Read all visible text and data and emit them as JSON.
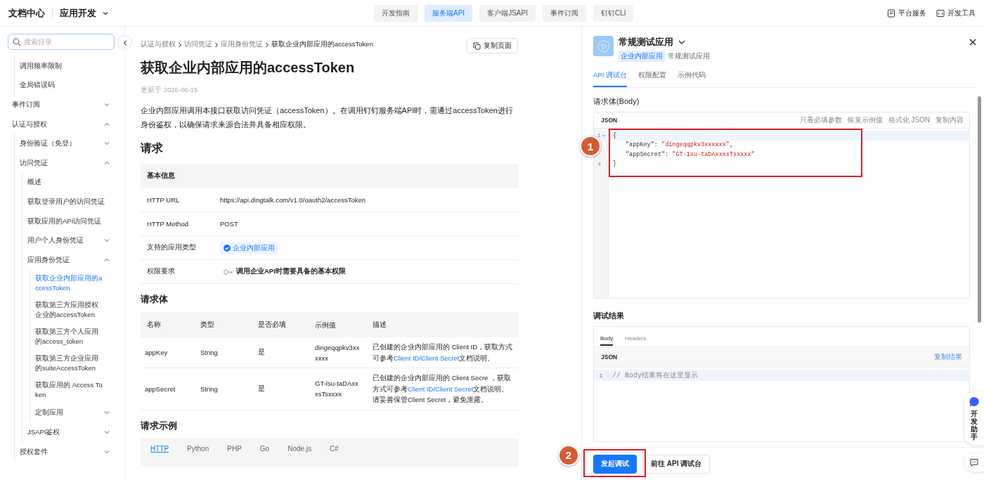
{
  "header": {
    "logo_text": "文档中心",
    "product": "应用开发",
    "nav_tabs": [
      {
        "label": "开发指南",
        "selected": false
      },
      {
        "label": "服务端API",
        "selected": true
      },
      {
        "label": "客户端JSAPI",
        "selected": false
      },
      {
        "label": "事件订阅",
        "selected": false
      },
      {
        "label": "钉钉CLI",
        "selected": false
      }
    ],
    "tools": [
      {
        "label": "平台服务",
        "kind": "doc"
      },
      {
        "label": "开发工具",
        "kind": "code"
      }
    ]
  },
  "sidebar": {
    "search": {
      "placeholder": "搜索目录"
    },
    "items": [
      {
        "children": [
          {
            "label": "调用频率限制",
            "selected": false
          },
          {
            "label": "全局错误码",
            "selected": false
          }
        ]
      },
      {
        "label": "事件订阅",
        "expanded": false,
        "selected": false
      },
      {
        "label": "认证与授权",
        "expanded": true,
        "selected": false,
        "children": [
          {
            "label": "身份验证（免登）",
            "expanded": false,
            "selected": false
          },
          {
            "label": "访问凭证",
            "expanded": true,
            "selected": false,
            "children": [
              {
                "label": "概述",
                "selected": false
              },
              {
                "label": "获取登录用户的访问凭证",
                "selected": false
              },
              {
                "label": "获取应用的API访问凭证",
                "selected": false
              },
              {
                "label": "用户个人身份凭证",
                "expanded": false,
                "selected": false
              },
              {
                "label": "应用身份凭证",
                "expanded": true,
                "selected": false,
                "children": [
                  {
                    "label": "获取企业内部应用的accessToken",
                    "selected": true
                  },
                  {
                    "label": "获取第三方应用授权企业的accessToken",
                    "selected": false
                  },
                  {
                    "label": "获取第三方个人应用的access_token",
                    "selected": false
                  },
                  {
                    "label": "获取第三方企业应用的suiteAccessToken",
                    "selected": false
                  },
                  {
                    "label": "获取应用的 Access Token",
                    "selected": false
                  },
                  {
                    "label": "定制应用",
                    "expanded": false,
                    "selected": false
                  }
                ]
              },
              {
                "label": "JSAPI鉴权",
                "expanded": false,
                "selected": false
              }
            ]
          },
          {
            "label": "授权套件",
            "expanded": false,
            "selected": false
          }
        ]
      }
    ]
  },
  "article": {
    "breadcrumb": [
      "认证与授权",
      "访问凭证",
      "应用身份凭证",
      "获取企业内部应用的accessToken"
    ],
    "copy_button": "复制页面",
    "title": "获取企业内部应用的accessToken",
    "updated": "更新于 2026-06-15",
    "description": "企业内部应用调用本接口获取访问凭证（accessToken）。在调用钉钉服务端API时，需通过accessToken进行身份鉴权，以确保请求来源合法并具备相应权限。",
    "request_heading": "请求",
    "basic_info": {
      "heading": "基本信息",
      "rows": [
        {
          "label": "HTTP URL",
          "kind": "text",
          "value": "https://api.dingtalk.com/v1.0/oauth2/accessToken"
        },
        {
          "label": "HTTP Method",
          "kind": "text",
          "value": "POST"
        },
        {
          "label": "支持的应用类型",
          "kind": "tag",
          "value": "企业内部应用"
        },
        {
          "label": "权限要求",
          "kind": "permission",
          "value": "调用企业API时需要具备的基本权限"
        }
      ]
    },
    "body_heading": "请求体",
    "body_table": {
      "columns": [
        "名称",
        "类型",
        "是否必填",
        "示例值",
        "描述"
      ],
      "rows": [
        {
          "name": "appKey",
          "type": "String",
          "required": "是",
          "example": "dingeqqpkv3xxxxxx",
          "description": [
            {
              "kind": "text",
              "text": "已创建的企业内部应用的 Client ID，获取方式可参考"
            },
            {
              "kind": "link",
              "text": "Client ID/Client Secret"
            },
            {
              "kind": "text",
              "text": "文档说明。"
            }
          ]
        },
        {
          "name": "appSecret",
          "type": "String",
          "required": "是",
          "example": "GT-lsu-taDAxxxsTsxxxx",
          "description": [
            {
              "kind": "text",
              "text": "已创建的企业内部应用的 Client Secre ，获取方式可参考"
            },
            {
              "kind": "link",
              "text": "Client ID/Client Secret"
            },
            {
              "kind": "text",
              "text": "文档说明。"
            }
          ],
          "note": "请妥善保管Client Secret，避免泄露。"
        }
      ]
    },
    "example_heading": "请求示例",
    "example_tabs": [
      {
        "label": "HTTP",
        "selected": true
      },
      {
        "label": "Python",
        "selected": false
      },
      {
        "label": "PHP",
        "selected": false
      },
      {
        "label": "Go",
        "selected": false
      },
      {
        "label": "Node.js",
        "selected": false
      },
      {
        "label": "C#",
        "selected": false
      }
    ]
  },
  "debug_panel": {
    "app": {
      "name": "常规测试应用",
      "tag": "企业内部应用",
      "subtitle": "常规测试应用"
    },
    "tabs": [
      {
        "label": "API 调试台",
        "selected": true
      },
      {
        "label": "权限配置",
        "selected": false
      },
      {
        "label": "示例代码",
        "selected": false
      }
    ],
    "body_heading": "请求体(Body)",
    "editor": {
      "format": "JSON",
      "actions": [
        "只看必填参数",
        "恢复示例值",
        "格式化 JSON",
        "复制内容"
      ],
      "lines": [
        {
          "number": "1",
          "kind": "brace",
          "text": "{"
        },
        {
          "kind": "pair",
          "key": "\"appKey\":",
          "value": "\"dingeqqpkv3xxxxxx\"",
          "tail": ","
        },
        {
          "kind": "pair",
          "key": "\"appSecret\":",
          "value": "\"GT-1su-taDAxxxsTsxxxx\""
        },
        {
          "number": "4",
          "kind": "brace",
          "text": "}"
        }
      ]
    },
    "result_heading": "调试结果",
    "result_tabs": [
      {
        "label": "Body",
        "selected": true
      },
      {
        "label": "Headers",
        "selected": false
      }
    ],
    "result": {
      "format": "JSON",
      "copy": "复制结果",
      "lines": [
        {
          "number": "1",
          "text": "// Body结果将在这里显示"
        }
      ]
    },
    "buttons": [
      {
        "label": "发起调试",
        "kind": "primary"
      },
      {
        "label": "前往 API 调试台",
        "kind": "default"
      }
    ]
  },
  "assistant": {
    "label": "开发助手"
  },
  "annotations": [
    {
      "label": "1"
    },
    {
      "label": "2"
    }
  ]
}
